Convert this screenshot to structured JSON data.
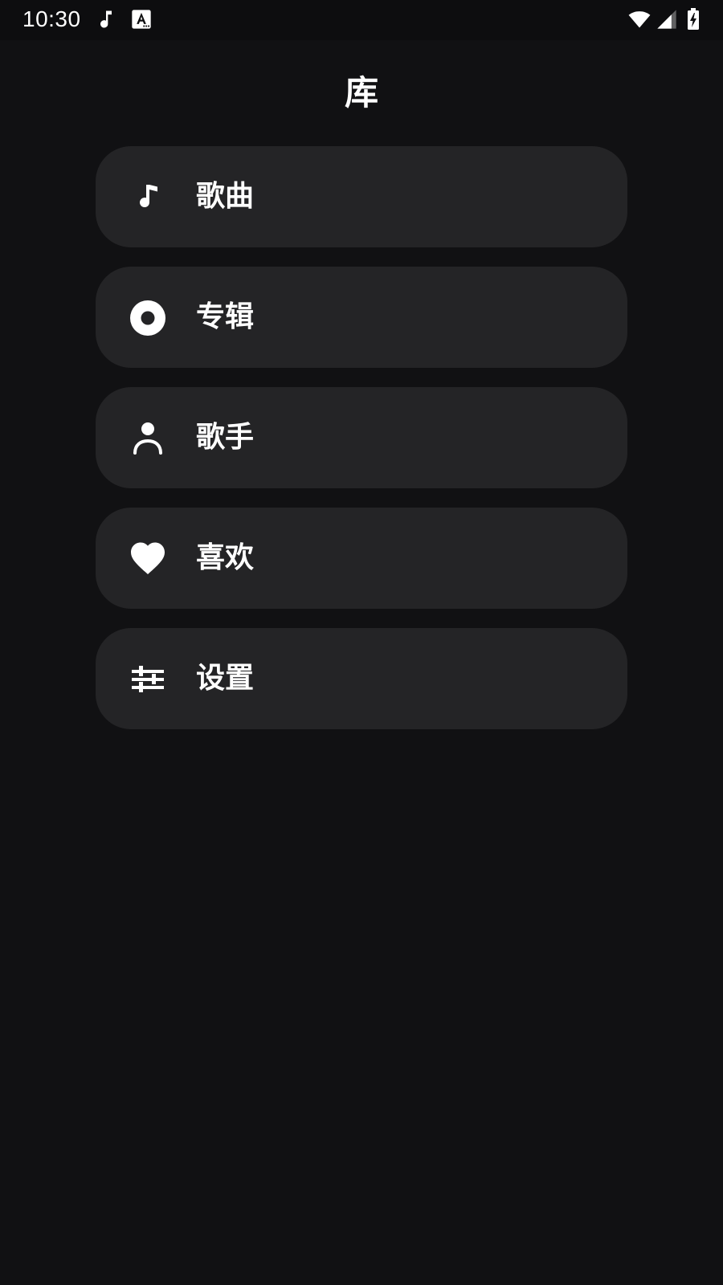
{
  "status_bar": {
    "time": "10:30",
    "notification_icons": [
      "music-note-icon",
      "text-a-icon"
    ],
    "system_icons": [
      "wifi-icon",
      "cellular-signal-icon",
      "battery-charging-icon"
    ]
  },
  "header": {
    "title": "库"
  },
  "menu": {
    "items": [
      {
        "label": "歌曲",
        "icon": "music-note-icon"
      },
      {
        "label": "专辑",
        "icon": "album-disc-icon"
      },
      {
        "label": "歌手",
        "icon": "person-icon"
      },
      {
        "label": "喜欢",
        "icon": "heart-icon"
      },
      {
        "label": "设置",
        "icon": "settings-sliders-icon"
      }
    ]
  },
  "colors": {
    "background": "#111113",
    "status_bar_background": "#0d0d0f",
    "card_background": "#242426",
    "text": "#ffffff"
  }
}
